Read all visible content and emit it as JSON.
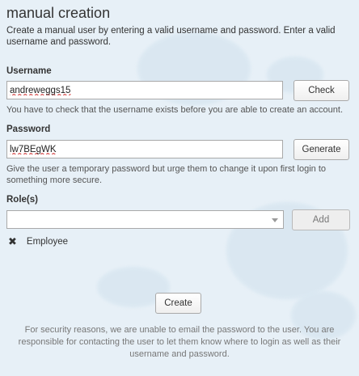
{
  "header": {
    "title": "manual creation",
    "intro": "Create a manual user by entering a valid username and password. Enter a valid username and password."
  },
  "username": {
    "label": "Username",
    "value": "andreweggs15",
    "check_label": "Check",
    "help": "You have to check that the username exists before you are able to create an account."
  },
  "password": {
    "label": "Password",
    "value": "lw7BEgWK",
    "generate_label": "Generate",
    "help": "Give the user a temporary password but urge them to change it upon first login to something more secure."
  },
  "roles": {
    "label": "Role(s)",
    "selected_value": "",
    "add_label": "Add",
    "items": [
      {
        "remove_icon": "✖",
        "label": "Employee"
      }
    ]
  },
  "actions": {
    "create_label": "Create"
  },
  "footer": {
    "note": "For security reasons, we are unable to email the password to the user.  You are responsible for contacting the user to let them know where to login as well as their username and password."
  },
  "colors": {
    "background": "#e7f0f7",
    "text": "#333333",
    "muted_text": "#777777",
    "error_underline": "#d23b3b"
  }
}
